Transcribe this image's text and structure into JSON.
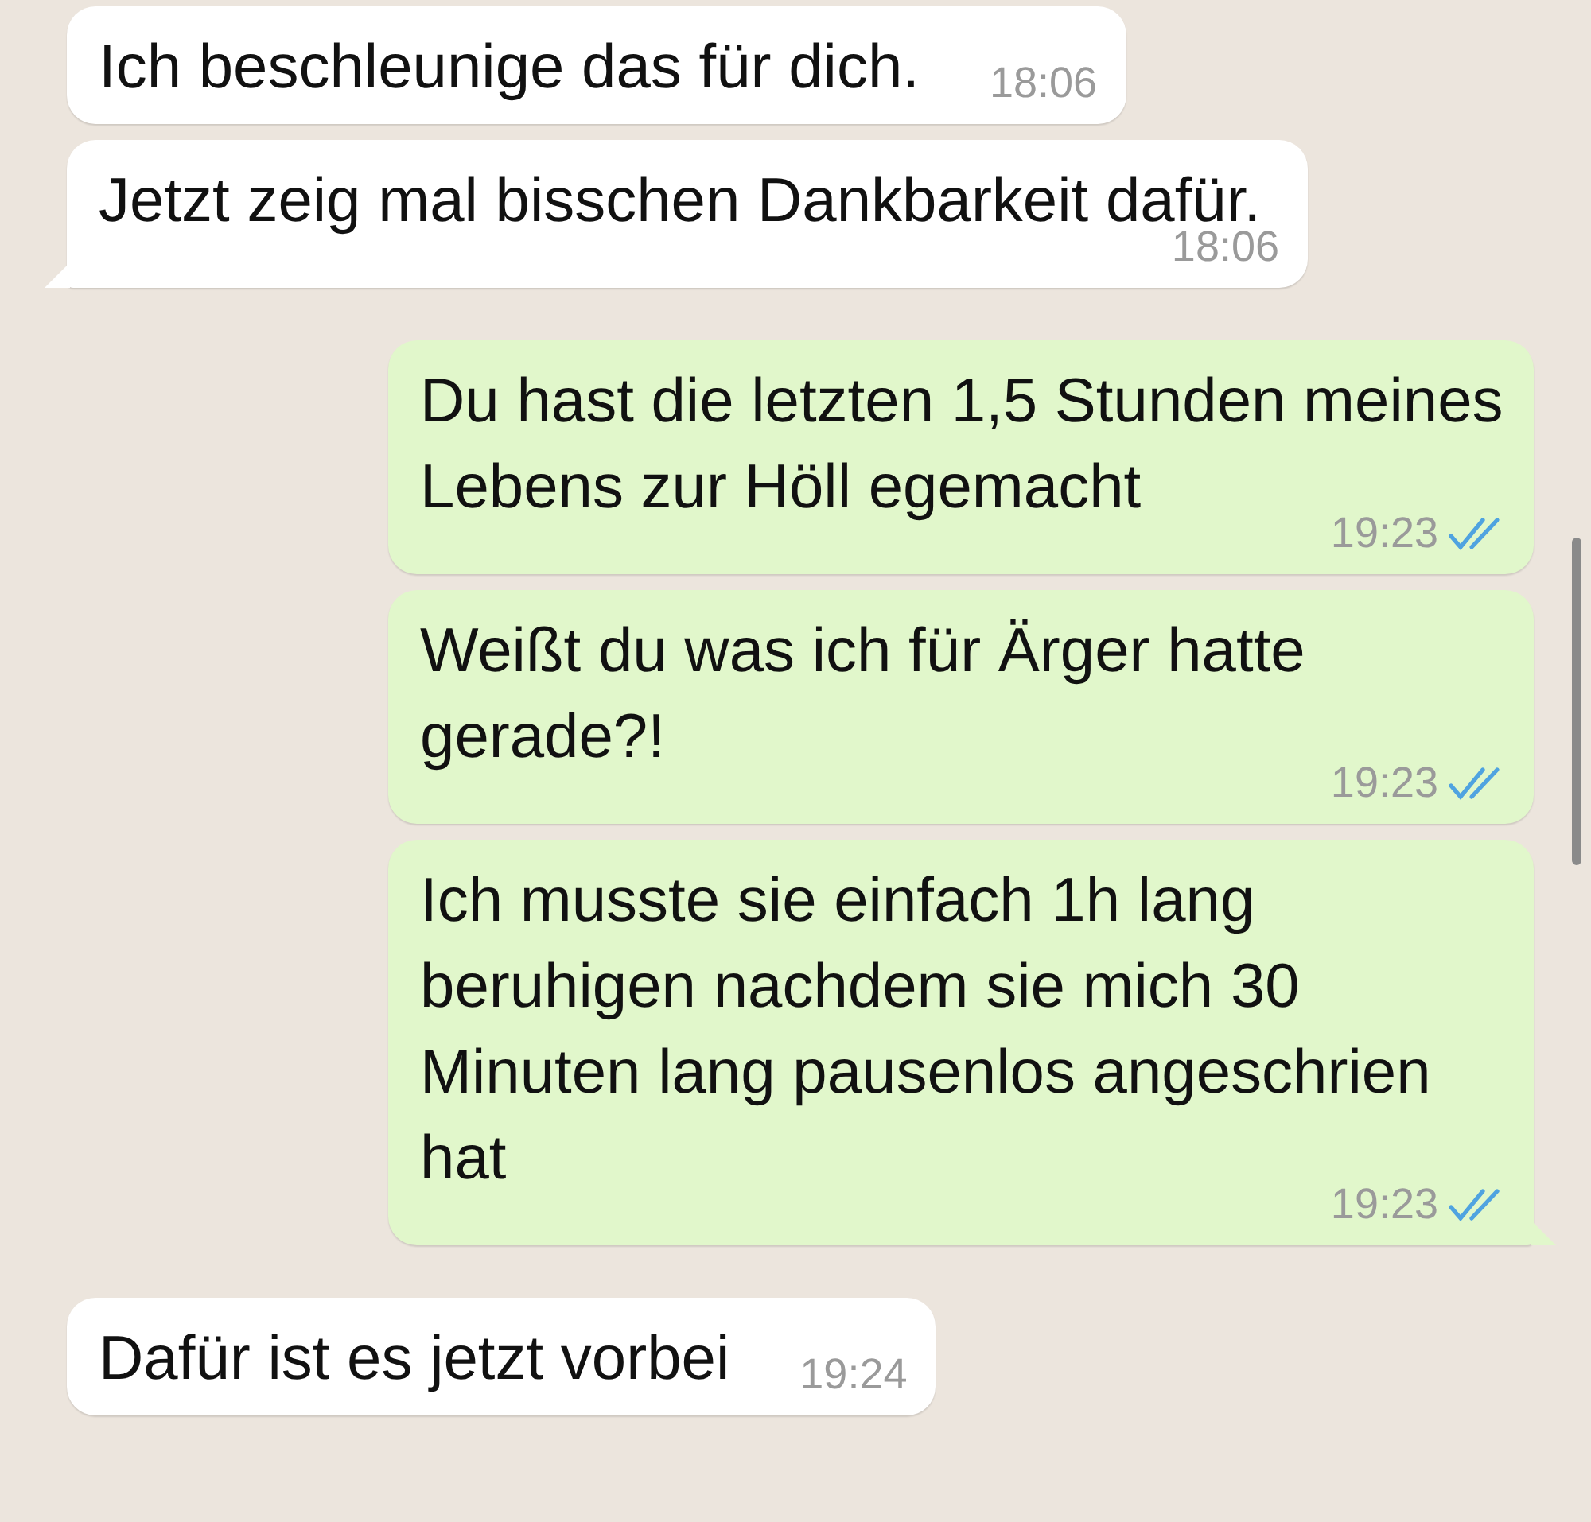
{
  "messages": [
    {
      "kind": "incoming",
      "text": "Ich beschleunige das für dich.",
      "time": "18:06",
      "tail": false
    },
    {
      "kind": "incoming",
      "text": "Jetzt zeig mal bisschen Dankbarkeit dafür.",
      "time": "18:06",
      "tail": true
    },
    {
      "kind": "outgoing",
      "text": "Du hast die letzten 1,5 Stunden meines Lebens zur Höll egemacht",
      "time": "19:23",
      "read": true,
      "tail": false
    },
    {
      "kind": "outgoing",
      "text": "Weißt du was ich für Ärger hatte gerade?!",
      "time": "19:23",
      "read": true,
      "tail": false
    },
    {
      "kind": "outgoing",
      "text": "Ich musste sie einfach 1h lang beruhigen nachdem sie mich 30 Minuten lang pausenlos angeschrien hat",
      "time": "19:23",
      "read": true,
      "tail": true
    },
    {
      "kind": "incoming",
      "text": "Dafür ist es jetzt vorbei",
      "time": "19:24",
      "tail": false
    }
  ]
}
